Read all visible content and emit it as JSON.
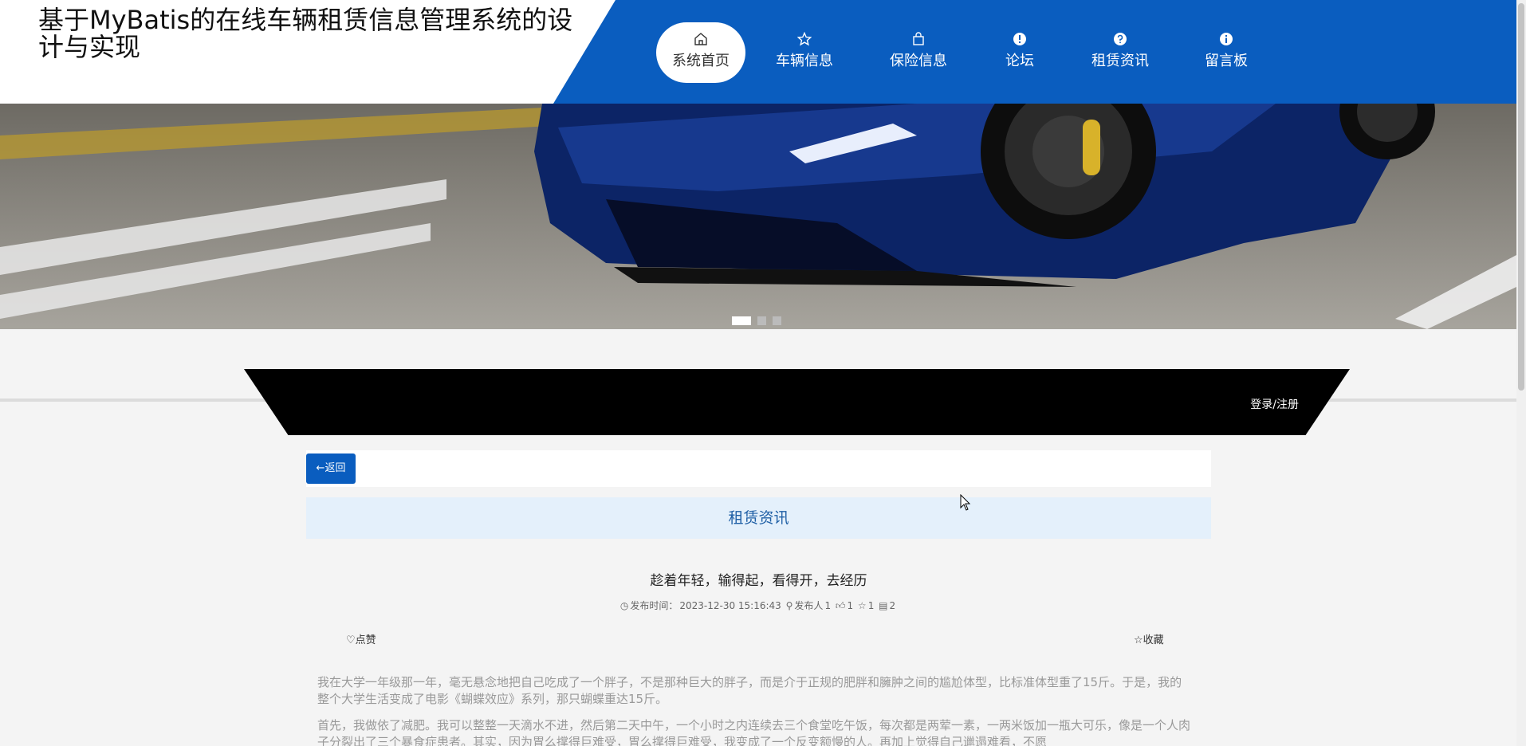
{
  "header": {
    "title": "基于MyBatis的在线车辆租赁信息管理系统的设计与实现"
  },
  "nav": {
    "items": [
      {
        "label": "系统首页",
        "icon": "home-icon",
        "active": true
      },
      {
        "label": "车辆信息",
        "icon": "star-icon",
        "active": false
      },
      {
        "label": "保险信息",
        "icon": "shopping-bag-icon",
        "active": false
      },
      {
        "label": "论坛",
        "icon": "exclamation-circle-icon",
        "active": false
      },
      {
        "label": "租赁资讯",
        "icon": "question-circle-icon",
        "active": false
      },
      {
        "label": "留言板",
        "icon": "info-circle-icon",
        "active": false
      }
    ]
  },
  "banner": {
    "slides_count": 3,
    "active_slide": 1
  },
  "auth": {
    "login_label": "登录/注册"
  },
  "back_button_label": "←返回",
  "section_title": "租赁资讯",
  "article": {
    "title": "趁着年轻，输得起，看得开，去经历",
    "publish_label": "发布时间：",
    "publish_time": "2023-12-30 15:16:43",
    "author_label": "发布人",
    "author": "1",
    "likes": "1",
    "favorites": "1",
    "clicks": "2",
    "like_label": "点赞",
    "favorite_label": "收藏",
    "paragraphs": [
      "我在大学一年级那一年，毫无悬念地把自己吃成了一个胖子，不是那种巨大的胖子，而是介于正规的肥胖和臃肿之间的尴尬体型，比标准体型重了15斤。于是，我的整个大学生活变成了电影《蝴蝶效应》系列，那只蝴蝶重达15斤。",
      "首先，我做依了减肥。我可以整整一天滴水不进，然后第二天中午，一个小时之内连续去三个食堂吃午饭，每次都是两荤一素，一两米饭加一瓶大可乐，像是一个人肉子分裂出了三个暴食症患者。其实，因为胃么撑得巨难受，胃么撑得巨难受，我变成了一个反变额慢的人。再加上觉得自己邋遢难看，不愿"
    ]
  },
  "colors": {
    "primary": "#0a5dbf",
    "section_bg": "#e4f0fb",
    "page_bg": "#f4f4f4"
  }
}
